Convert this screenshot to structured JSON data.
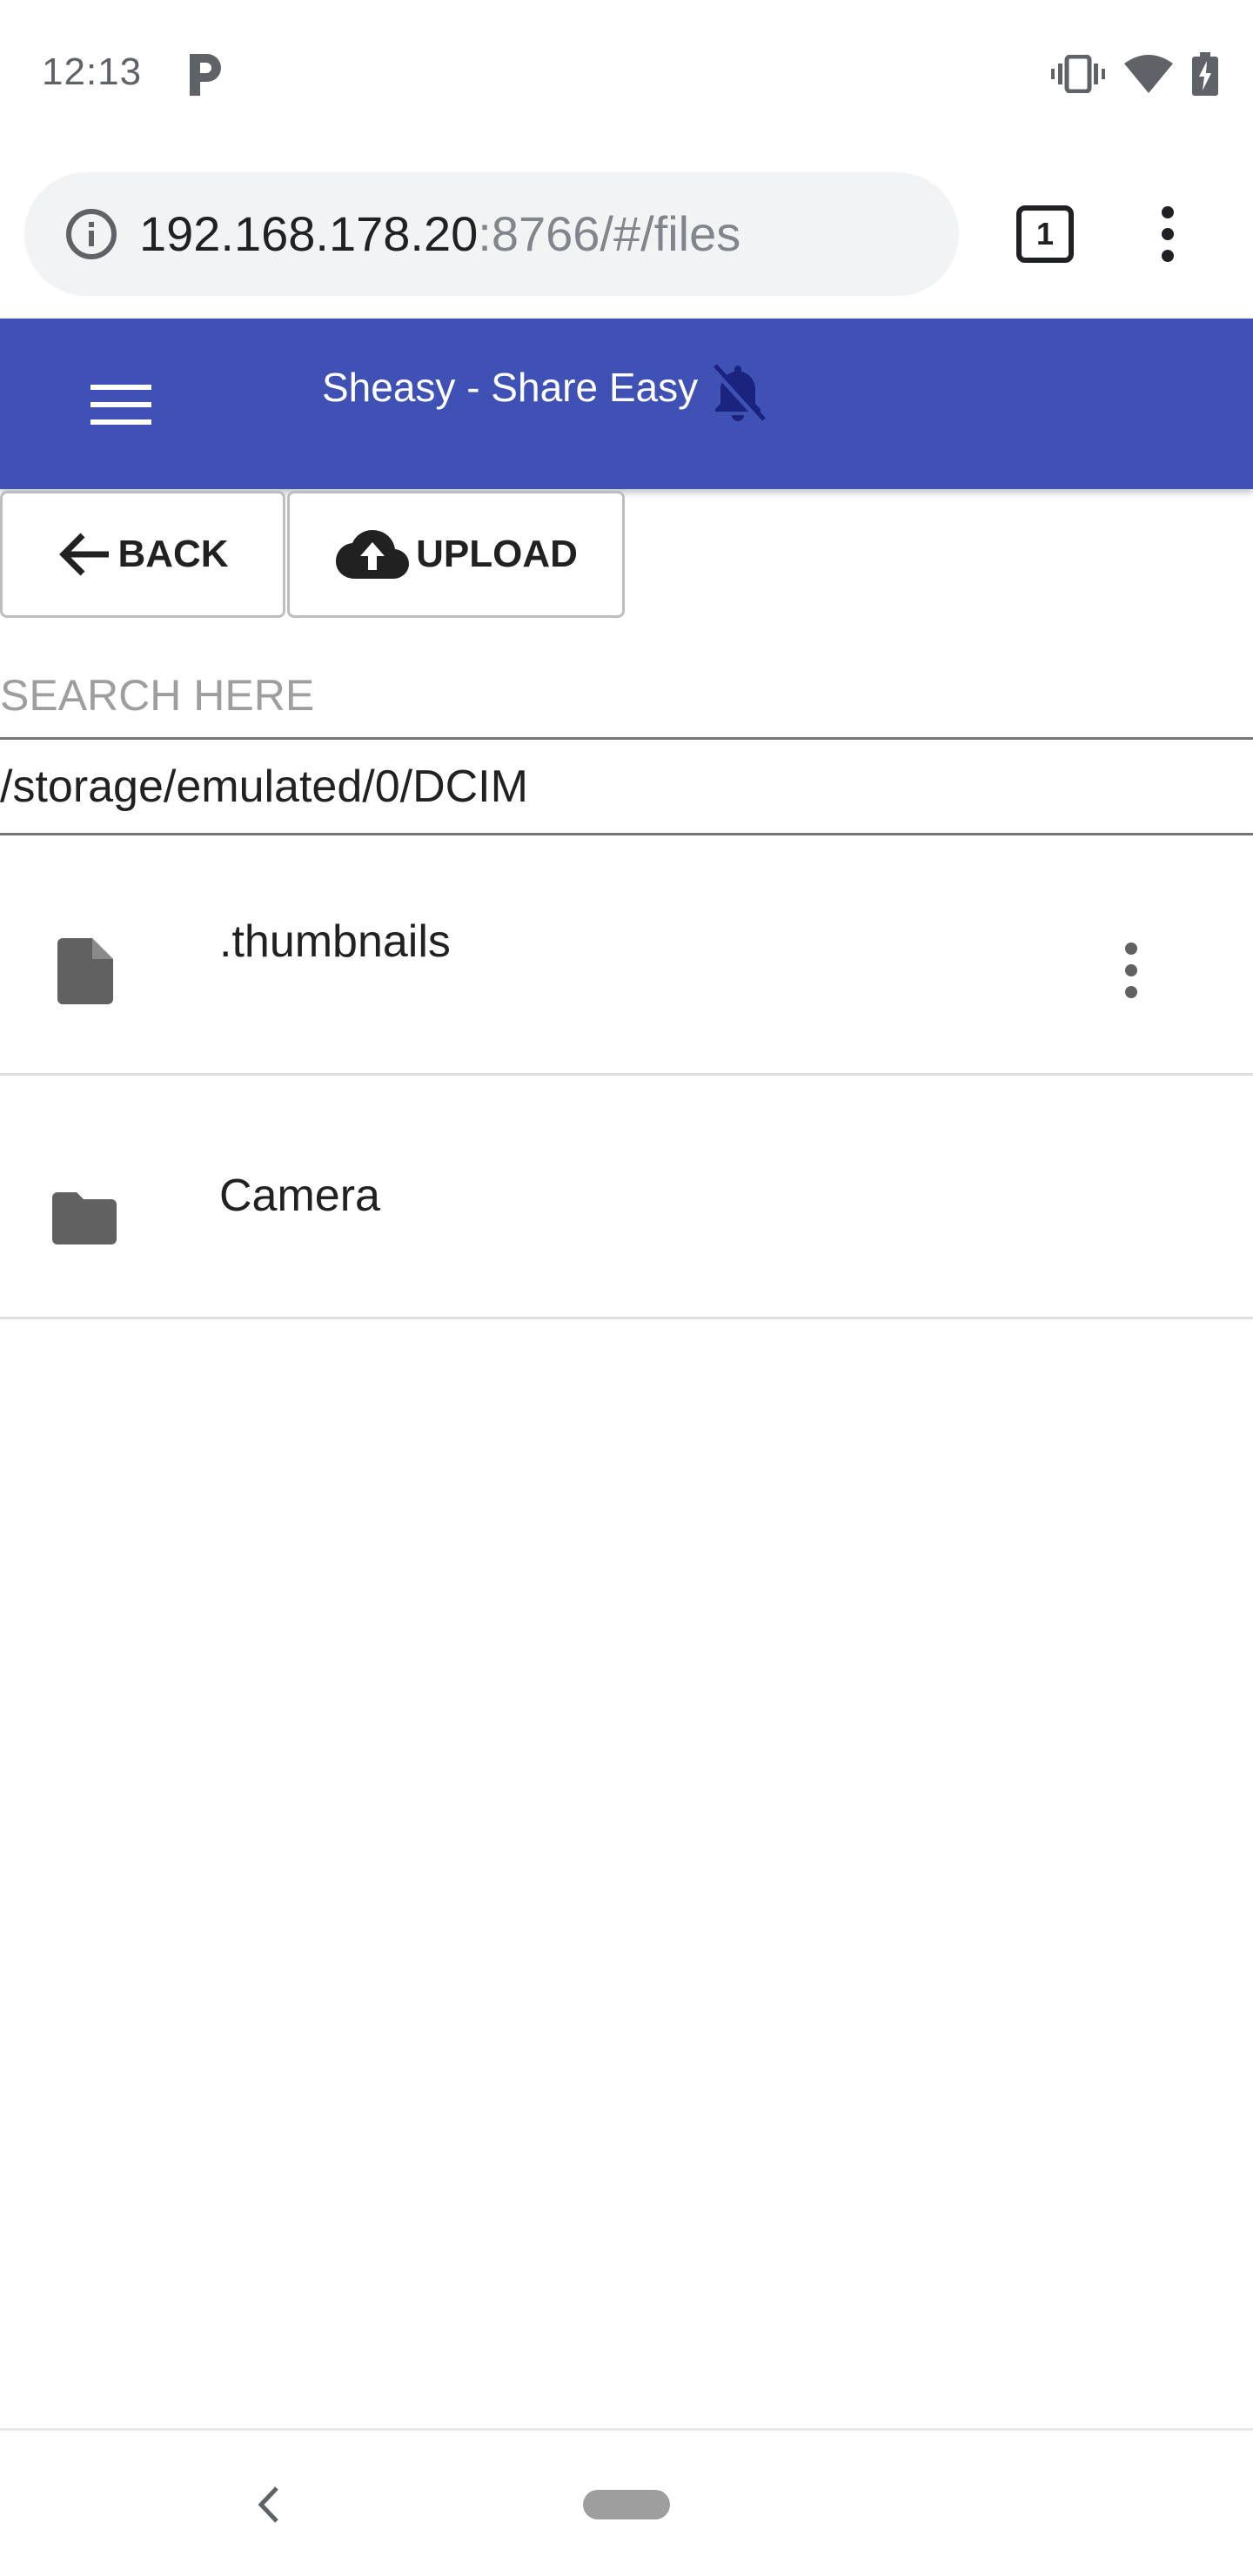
{
  "status_bar": {
    "time": "12:13"
  },
  "browser": {
    "url_host": "192.168.178.20",
    "url_rest": ":8766/#/files",
    "tab_count": "1"
  },
  "app_bar": {
    "title": "Sheasy - Share Easy"
  },
  "toolbar": {
    "back_label": "BACK",
    "upload_label": "UPLOAD"
  },
  "search": {
    "placeholder": "SEARCH HERE",
    "value": ""
  },
  "path": "/storage/emulated/0/DCIM",
  "files": [
    {
      "name": ".thumbnails",
      "icon": "file-icon",
      "has_menu": true
    },
    {
      "name": "Camera",
      "icon": "folder-icon",
      "has_menu": false
    }
  ],
  "colors": {
    "app_bar": "#3f51b5",
    "url_bar_bg": "#f1f3f4"
  }
}
